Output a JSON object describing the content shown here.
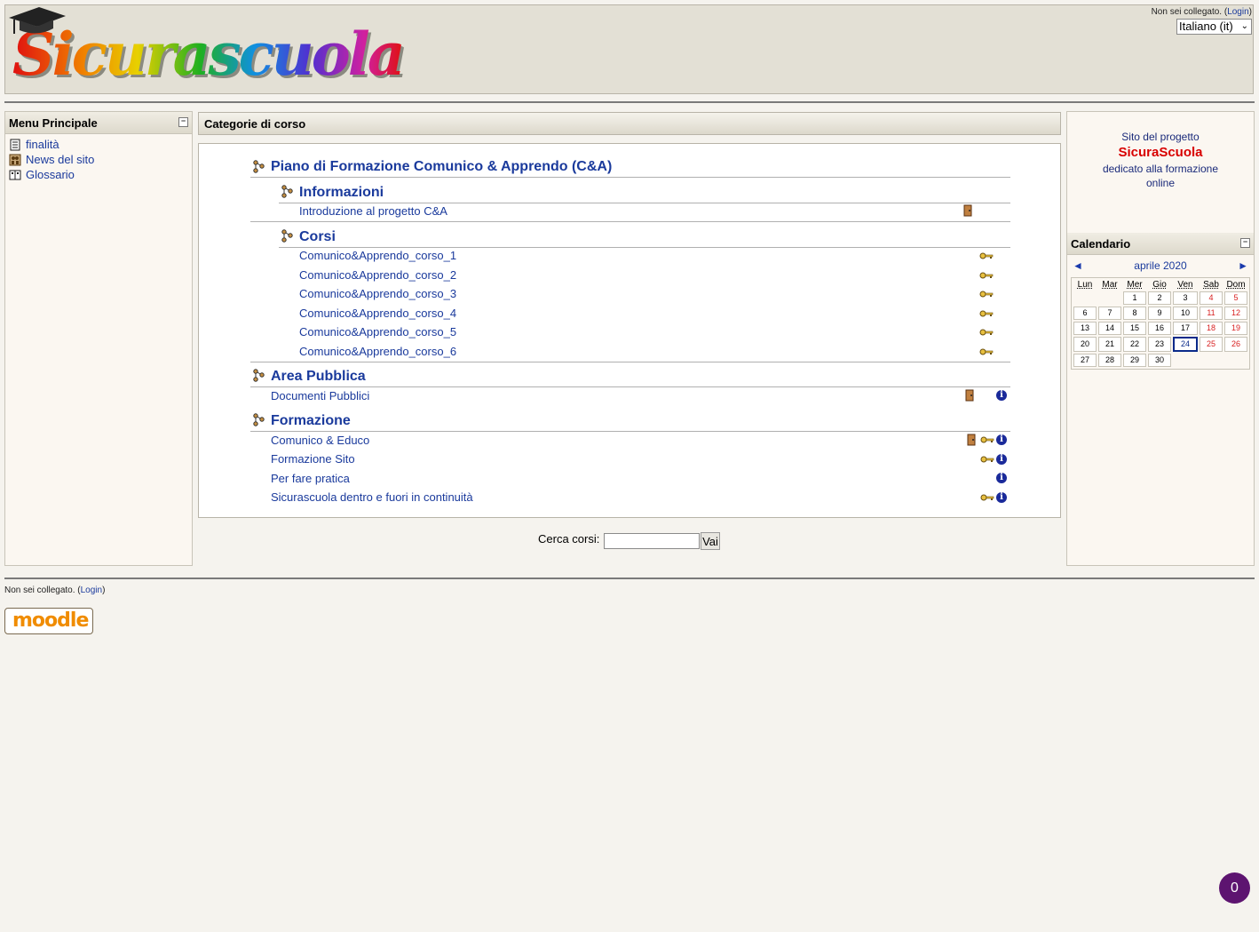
{
  "header": {
    "logo_text": "Sicurascuola",
    "login_status": "Non sei collegato.",
    "login_link": "Login",
    "language": "Italiano (it)"
  },
  "main_menu": {
    "title": "Menu Principale",
    "items": [
      {
        "label": "finalità",
        "icon": "document-icon"
      },
      {
        "label": "News del sito",
        "icon": "forum-icon"
      },
      {
        "label": "Glossario",
        "icon": "glossary-icon"
      }
    ]
  },
  "categories": {
    "header": "Categorie di corso",
    "groups": [
      {
        "title": "Piano di Formazione Comunico & Apprendo (C&A)"
      },
      {
        "title": "Informazioni",
        "courses": [
          {
            "name": "Introduzione al progetto C&A",
            "icons": [
              "door-icon"
            ]
          }
        ]
      },
      {
        "title": "Corsi",
        "courses": [
          {
            "name": "Comunico&Apprendo_corso_1",
            "icons": [
              "key-icon"
            ]
          },
          {
            "name": "Comunico&Apprendo_corso_2",
            "icons": [
              "key-icon"
            ]
          },
          {
            "name": "Comunico&Apprendo_corso_3",
            "icons": [
              "key-icon"
            ]
          },
          {
            "name": "Comunico&Apprendo_corso_4",
            "icons": [
              "key-icon"
            ]
          },
          {
            "name": "Comunico&Apprendo_corso_5",
            "icons": [
              "key-icon"
            ]
          },
          {
            "name": "Comunico&Apprendo_corso_6",
            "icons": [
              "key-icon"
            ]
          }
        ]
      },
      {
        "title": "Area Pubblica",
        "courses": [
          {
            "name": "Documenti Pubblici",
            "icons": [
              "door-icon",
              "info-icon"
            ]
          }
        ]
      },
      {
        "title": "Formazione",
        "courses": [
          {
            "name": "Comunico & Educo",
            "icons": [
              "door-icon",
              "key-icon",
              "info-icon"
            ]
          },
          {
            "name": "Formazione Sito",
            "icons": [
              "key-icon",
              "info-icon"
            ]
          },
          {
            "name": "Per fare pratica",
            "icons": [
              "info-icon"
            ]
          },
          {
            "name": "Sicurascuola dentro e fuori in continuità",
            "icons": [
              "key-icon",
              "info-icon"
            ]
          }
        ]
      }
    ]
  },
  "search": {
    "label": "Cerca corsi:",
    "value": "",
    "button": "Vai"
  },
  "project_block": {
    "line1": "Sito del progetto",
    "brand": "SicuraScuola",
    "line2": "dedicato alla formazione",
    "line3": "online"
  },
  "calendar": {
    "title": "Calendario",
    "month": "aprile 2020",
    "prev": "◄",
    "next": "►",
    "weekdays": [
      "Lun",
      "Mar",
      "Mer",
      "Gio",
      "Ven",
      "Sab",
      "Dom"
    ],
    "weeks": [
      [
        "",
        "",
        "1",
        "2",
        "3",
        "4",
        "5"
      ],
      [
        "6",
        "7",
        "8",
        "9",
        "10",
        "11",
        "12"
      ],
      [
        "13",
        "14",
        "15",
        "16",
        "17",
        "18",
        "19"
      ],
      [
        "20",
        "21",
        "22",
        "23",
        "24",
        "25",
        "26"
      ],
      [
        "27",
        "28",
        "29",
        "30",
        "",
        "",
        ""
      ]
    ],
    "today": "24"
  },
  "footer": {
    "login_status": "Non sei collegato.",
    "login_link": "Login",
    "logo_text": "moodle"
  },
  "badge": {
    "count": "0"
  },
  "colors": {
    "link": "#1a3a9c",
    "brand_red": "#d80000",
    "weekend": "#d82020",
    "badge": "#5d1470"
  }
}
